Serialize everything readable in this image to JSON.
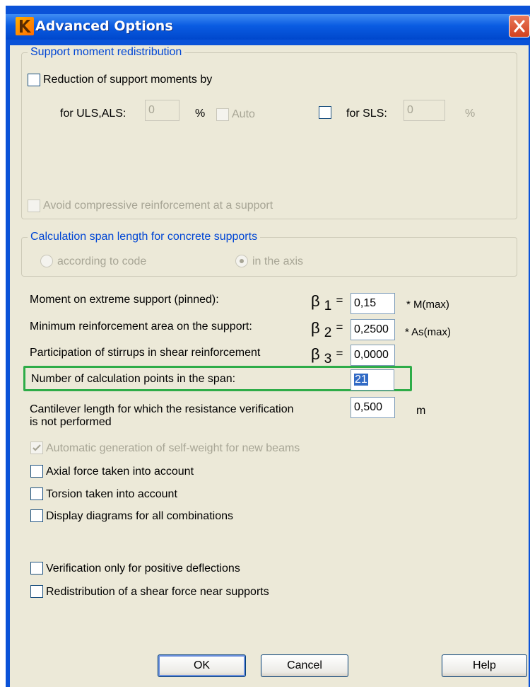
{
  "window": {
    "title": "Advanced Options"
  },
  "support_group": {
    "legend": "Support moment redistribution",
    "reduction_label": "Reduction of support moments by",
    "uls_label": "for ULS,ALS:",
    "uls_value": "0",
    "uls_unit": "%",
    "auto_label": "Auto",
    "sls_label": "for SLS:",
    "sls_value": "0",
    "sls_unit": "%",
    "avoid_label": "Avoid compressive reinforcement at a support"
  },
  "span_group": {
    "legend": "Calculation span length for concrete supports",
    "option1": "according to code",
    "option2": "in the axis"
  },
  "params": {
    "moment_label": "Moment on extreme support (pinned):",
    "beta1_symbol": "β",
    "beta1_sub": "1",
    "beta1_eq": "=",
    "beta1_value": "0,15",
    "beta1_unit": "* M(max)",
    "minreinf_label": "Minimum reinforcement area on the support:",
    "beta2_symbol": "β",
    "beta2_sub": "2",
    "beta2_eq": "=",
    "beta2_value": "0,2500",
    "beta2_unit": "* As(max)",
    "stirrups_label": "Participation of stirrups in shear reinforcement",
    "beta3_symbol": "β",
    "beta3_sub": "3",
    "beta3_eq": "=",
    "beta3_value": "0,0000",
    "calcpoints_label": "Number of calculation points in the span:",
    "calcpoints_value": "21",
    "cantilever_label_line1": "Cantilever length for which the resistance verification",
    "cantilever_label_line2": "is not performed",
    "cantilever_value": "0,500",
    "cantilever_unit": "m"
  },
  "options": {
    "selfweight": "Automatic generation of self-weight for new beams",
    "axial": "Axial force taken into account",
    "torsion": "Torsion taken into account",
    "display_diagrams": "Display diagrams for all combinations",
    "verification_positive": "Verification only for positive deflections",
    "redistribution_shear": "Redistribution of a shear force near supports"
  },
  "buttons": {
    "ok": "OK",
    "cancel": "Cancel",
    "help": "Help"
  },
  "colors": {
    "titlebar": "#0a5ce2",
    "group_legend": "#0046d5",
    "highlight": "#2eac48",
    "dialog_bg": "#ece9d8"
  }
}
